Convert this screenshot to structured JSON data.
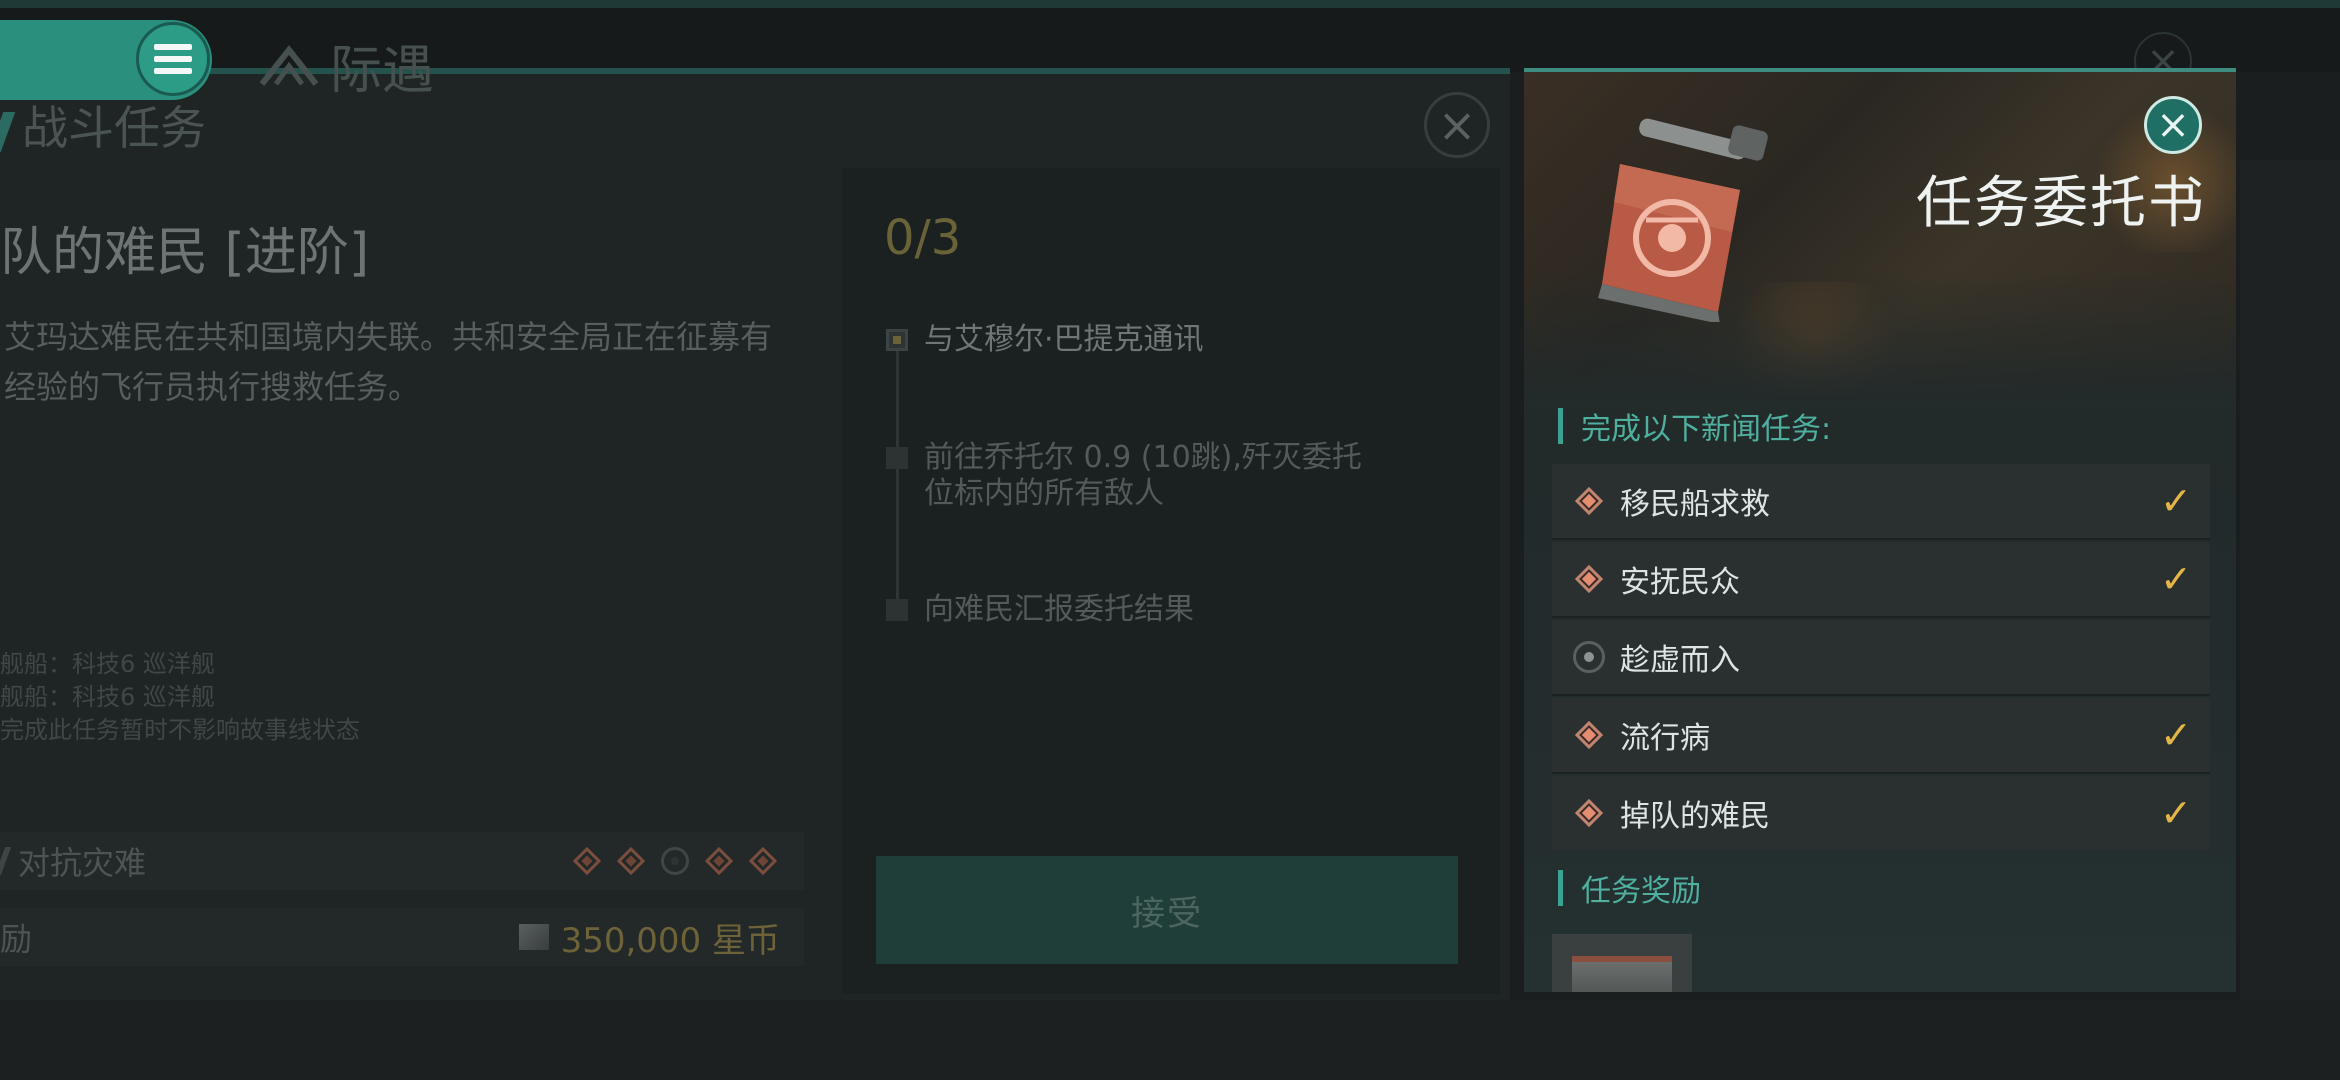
{
  "app": {
    "title": "际遇"
  },
  "left_dialog": {
    "section_title": "战斗任务",
    "mission_title": "队的难民 [进阶]",
    "description": "艾玛达难民在共和国境内失联。共和安全局正在征募有经验的飞行员执行搜救任务。",
    "notes": [
      "舰船：科技6 巡洋舰",
      "舰船：科技6 巡洋舰",
      "完成此任务暂时不影响故事线状态"
    ],
    "storyline_label": "对抗灾难",
    "storyline_progress": [
      true,
      true,
      false,
      true,
      true
    ],
    "reward_label": "励",
    "reward_value": "350,000 星币"
  },
  "objectives": {
    "progress": "0/3",
    "items": [
      {
        "text": "与艾穆尔·巴提克通讯",
        "active": true
      },
      {
        "text": "前往乔托尔 0.9 (10跳),歼灭委托位标内的所有敌人",
        "active": false
      },
      {
        "text": "向难民汇报委托结果",
        "active": false
      }
    ],
    "accept_label": "接受"
  },
  "commission": {
    "title": "任务委托书",
    "tasks_header": "完成以下新闻任务:",
    "tasks": [
      {
        "name": "移民船求救",
        "icon": "diamond-icon",
        "done": true
      },
      {
        "name": "安抚民众",
        "icon": "diamond-icon",
        "done": true
      },
      {
        "name": "趁虚而入",
        "icon": "circle-icon",
        "done": false
      },
      {
        "name": "流行病",
        "icon": "diamond-icon",
        "done": true
      },
      {
        "name": "掉队的难民",
        "icon": "diamond-icon",
        "done": true
      }
    ],
    "check_glyph": "✓",
    "rewards_header": "任务奖励"
  },
  "colors": {
    "accent": "#3aa392",
    "check": "#e5b546",
    "gold": "#6b6338",
    "task_diamond": "#e48d70"
  }
}
